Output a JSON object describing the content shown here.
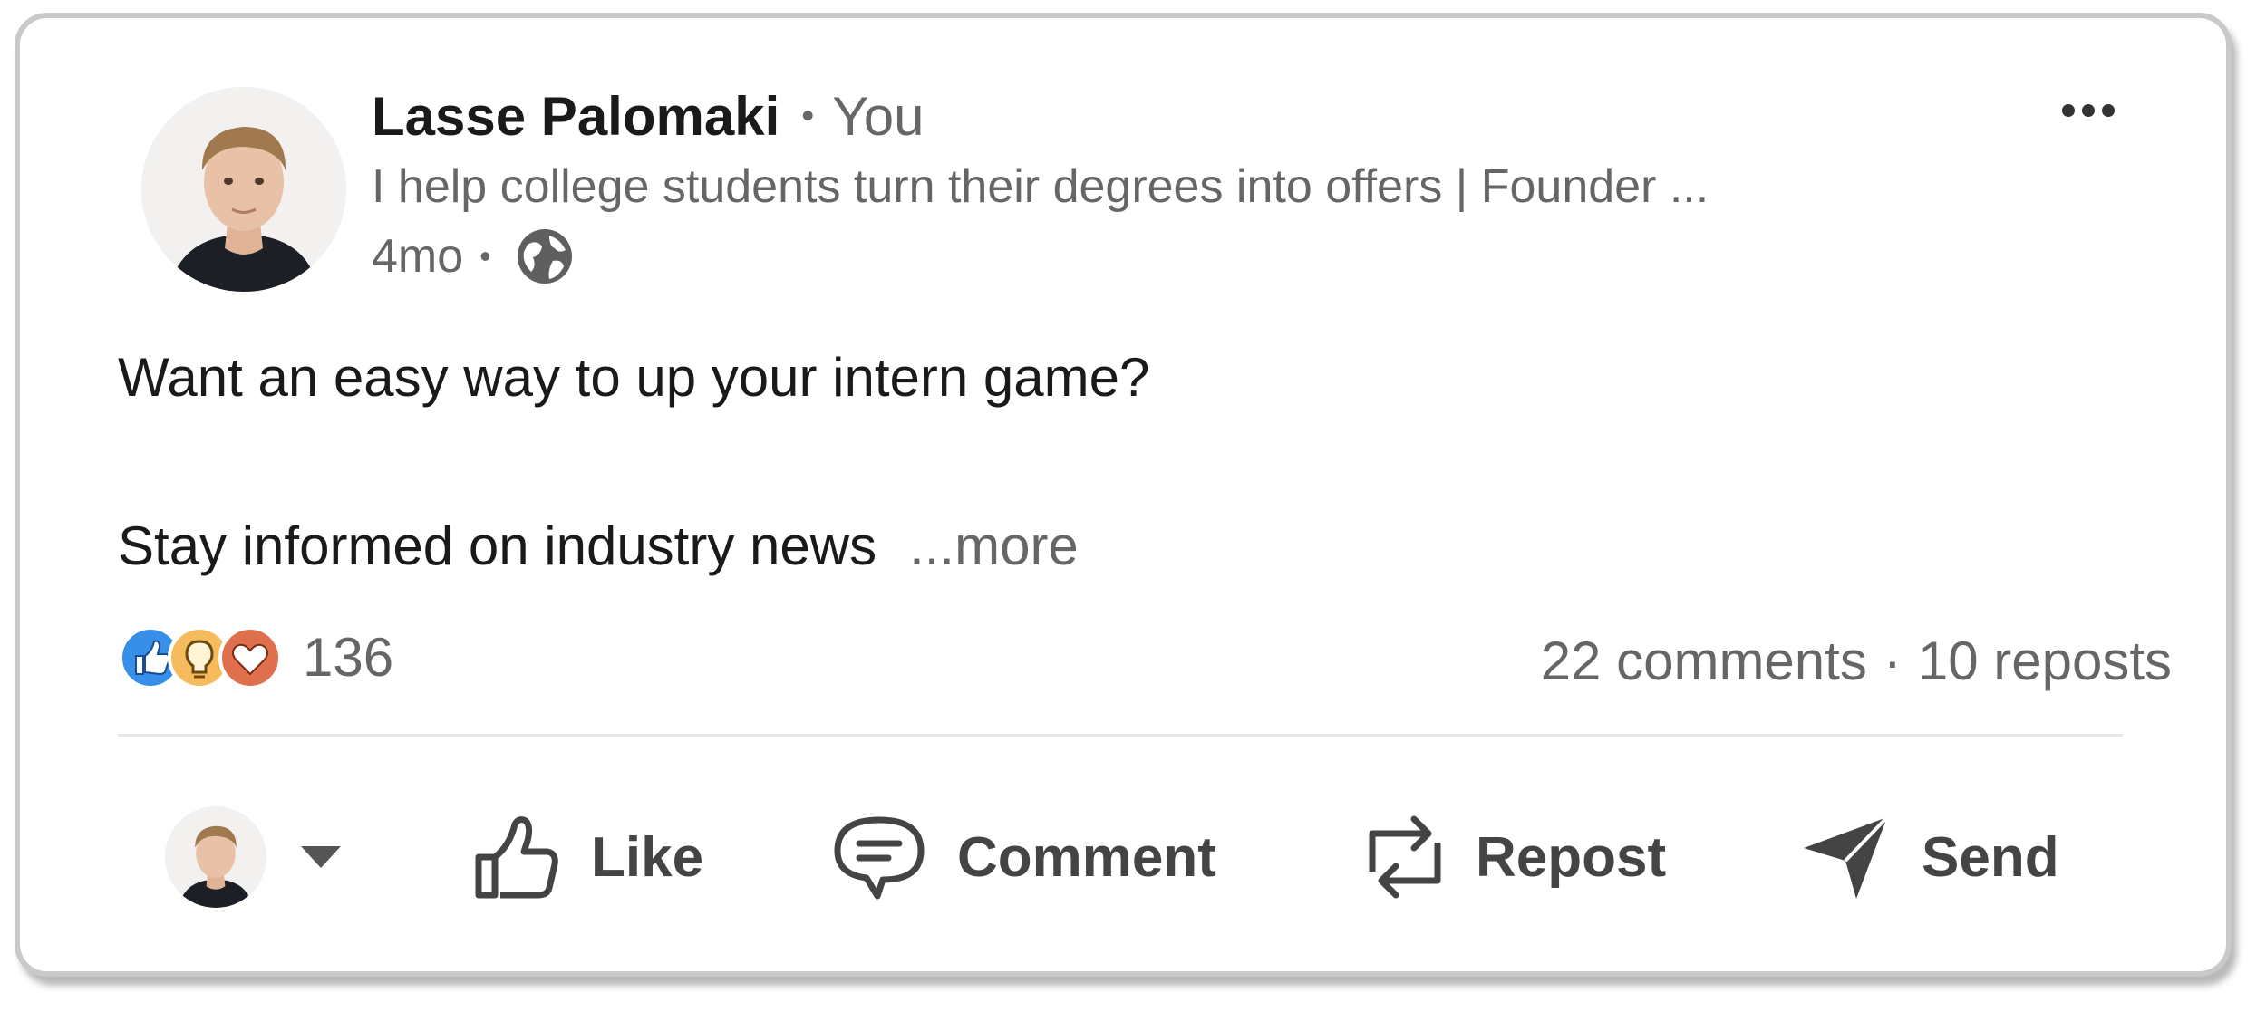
{
  "post": {
    "author_name": "Lasse Palomaki",
    "separator": "•",
    "relation": "You",
    "headline": "I help college students turn their degrees into offers | Founder ...",
    "age": "4mo",
    "visibility_icon": "globe-icon",
    "text_line1": "Want an easy way to up your intern game?",
    "text_line2": "Stay informed on industry news",
    "more_link": "...more",
    "menu_icon": "more-horizontal-icon"
  },
  "social": {
    "reaction_icons": [
      "like-reaction-icon",
      "insightful-reaction-icon",
      "love-reaction-icon"
    ],
    "reaction_count": "136",
    "comments": "22 comments",
    "dot": "·",
    "reposts": "10 reposts"
  },
  "actions": {
    "like": "Like",
    "comment": "Comment",
    "repost": "Repost",
    "send": "Send"
  },
  "colors": {
    "like_blue": "#378fe9",
    "insightful_yellow": "#f5bb5c",
    "love_red": "#df704d",
    "text_primary": "#1a1a1a",
    "text_secondary": "#666666"
  }
}
